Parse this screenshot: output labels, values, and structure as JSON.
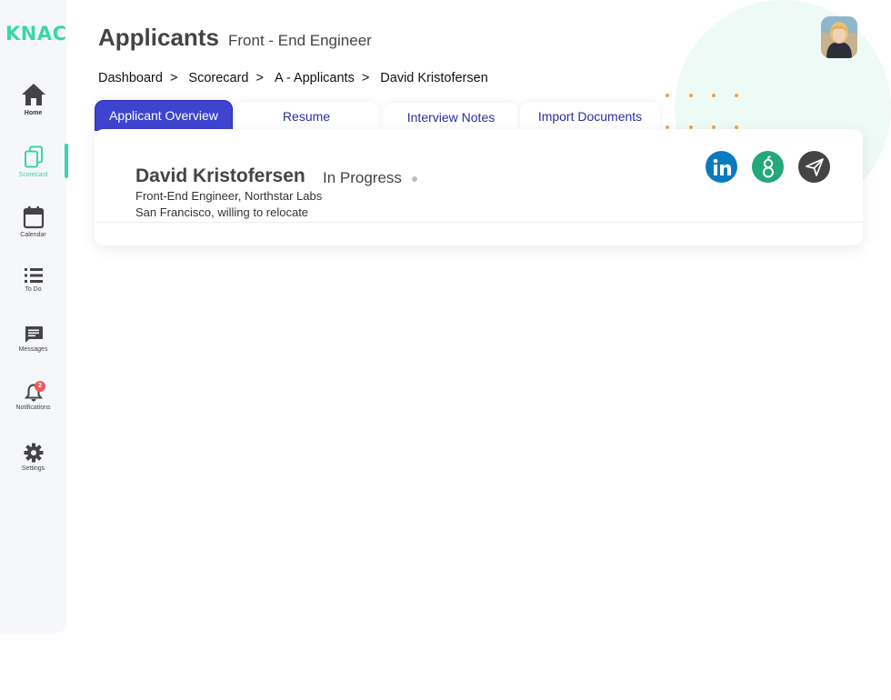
{
  "brand": {
    "logo": "KNAC",
    "accent": "#3ad6a9"
  },
  "sidebar": {
    "items": [
      {
        "label": "Home",
        "icon": "home-icon"
      },
      {
        "label": "Scorecard",
        "icon": "scorecard-icon",
        "active": true
      },
      {
        "label": "Calendar",
        "icon": "calendar-icon"
      },
      {
        "label": "To Do",
        "icon": "list-icon"
      },
      {
        "label": "Messages",
        "icon": "message-icon"
      },
      {
        "label": "Notifications",
        "icon": "bell-icon",
        "badge": "2"
      },
      {
        "label": "Settings",
        "icon": "gear-icon"
      }
    ]
  },
  "header": {
    "title": "Applicants",
    "subtitle": "Front - End Engineer"
  },
  "breadcrumb": [
    {
      "label": "Dashboard",
      "sep": ">"
    },
    {
      "label": "Scorecard",
      "sep": ">"
    },
    {
      "label": "A - Applicants",
      "sep": ">"
    },
    {
      "label": "David Kristofersen"
    }
  ],
  "tabs": [
    {
      "label": "Applicant Overview",
      "active": true
    },
    {
      "label": "Resume"
    },
    {
      "label": "Interview Notes"
    },
    {
      "label": "Import Documents"
    }
  ],
  "applicant": {
    "name": "David Kristofersen",
    "status": "In Progress",
    "role": "Front-End Engineer, Northstar Labs",
    "location": "San Francisco, willing to relocate"
  },
  "social": {
    "linkedin": {
      "icon": "linkedin-icon",
      "color": "#0a7bc0"
    },
    "greenhouse": {
      "icon": "greenhouse-icon",
      "color": "#23a87a"
    },
    "send": {
      "icon": "send-icon",
      "color": "#444444"
    }
  }
}
